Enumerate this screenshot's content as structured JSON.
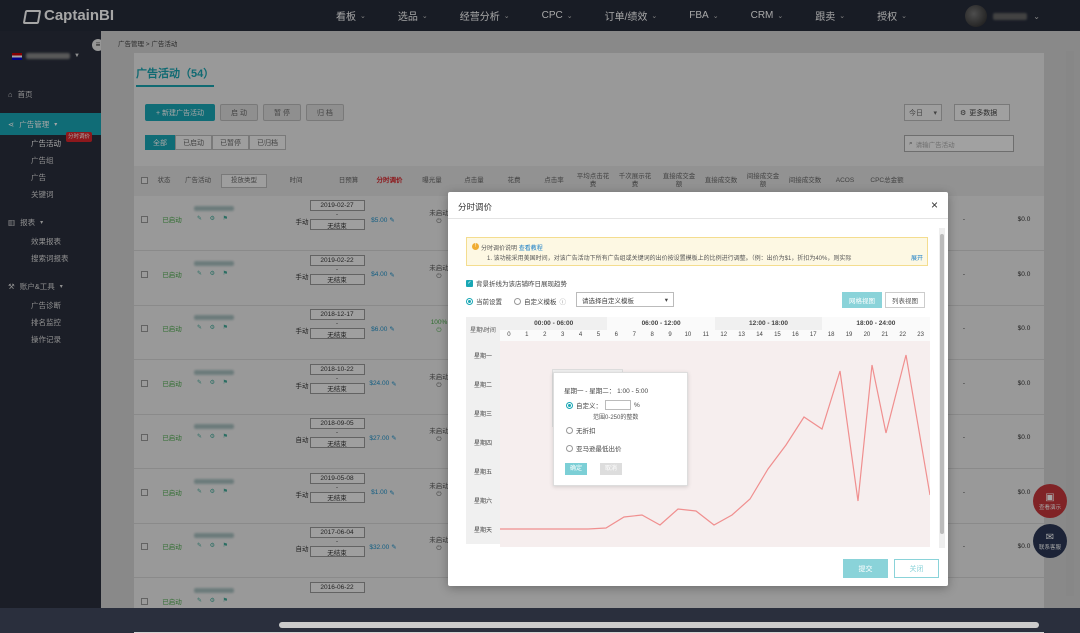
{
  "app": {
    "logo_text": "CaptainBI"
  },
  "nav": [
    {
      "label": "看板"
    },
    {
      "label": "选品"
    },
    {
      "label": "经营分析"
    },
    {
      "label": "CPC"
    },
    {
      "label": "订单/绩效"
    },
    {
      "label": "FBA"
    },
    {
      "label": "CRM"
    },
    {
      "label": "跟卖"
    },
    {
      "label": "授权"
    }
  ],
  "sidebar": {
    "groups": [
      {
        "label": "首页",
        "icon": "home-icon"
      },
      {
        "label": "广告管理",
        "icon": "share-icon",
        "active": true,
        "items": [
          {
            "label": "广告活动",
            "active": true,
            "badge": "分时调价"
          },
          {
            "label": "广告组"
          },
          {
            "label": "广告"
          },
          {
            "label": "关键词"
          }
        ]
      },
      {
        "label": "报表",
        "icon": "chart-icon",
        "items": [
          {
            "label": "效果报表"
          },
          {
            "label": "搜索词报表"
          }
        ]
      },
      {
        "label": "账户&工具",
        "icon": "tools-icon",
        "items": [
          {
            "label": "广告诊断"
          },
          {
            "label": "排名监控"
          },
          {
            "label": "操作记录"
          }
        ]
      }
    ]
  },
  "breadcrumb": "广告管理 > 广告活动",
  "page": {
    "title": "广告活动（54）",
    "toolbar": {
      "new": "+ 新建广告活动",
      "enable": "启 动",
      "pause": "暂 停",
      "archive": "归 档"
    },
    "tabs": [
      "全部",
      "已启动",
      "已暂停",
      "已归档"
    ],
    "period": "今日",
    "more_data": "更多数据",
    "search_placeholder": "请输广告活动"
  },
  "table": {
    "headers": [
      "状态",
      "广告活动",
      "投放类型",
      "时间",
      "日预算",
      "分时调价",
      "曝光量",
      "点击量",
      "花费",
      "点击率",
      "平均点击花费",
      "千次展示花费",
      "直接成交金额",
      "直接成交数",
      "间接成交金额",
      "间接成交数",
      "ACOS",
      "CPC总金额"
    ],
    "rows": [
      {
        "status": "已启动",
        "type": "手动",
        "start": "2019-02-27",
        "end": "无结束",
        "budget": "$5.00",
        "tp": "未启动",
        "last": "$0.0"
      },
      {
        "status": "已启动",
        "type": "手动",
        "start": "2019-02-22",
        "end": "无结束",
        "budget": "$4.00",
        "tp": "未启动",
        "last": "$0.0"
      },
      {
        "status": "已启动",
        "type": "手动",
        "start": "2018-12-17",
        "end": "无结束",
        "budget": "$6.00",
        "tp": "100%",
        "last": "$0.0"
      },
      {
        "status": "已启动",
        "type": "手动",
        "start": "2018-10-22",
        "end": "无结束",
        "budget": "$24.00",
        "tp": "未启动",
        "last": "$0.0"
      },
      {
        "status": "已启动",
        "type": "自动",
        "start": "2018-09-05",
        "end": "无结束",
        "budget": "$27.00",
        "tp": "未启动",
        "last": "$0.0"
      },
      {
        "status": "已启动",
        "type": "手动",
        "start": "2019-05-08",
        "end": "无结束",
        "budget": "$1.00",
        "tp": "未启动",
        "last": "$0.0"
      },
      {
        "status": "已启动",
        "type": "自动",
        "start": "2017-06-04",
        "end": "无结束",
        "budget": "$32.00",
        "tp": "未启动",
        "last": "$0.0"
      },
      {
        "status": "已启动",
        "type": "",
        "start": "2016-06-22",
        "end": "",
        "budget": "",
        "tp": "",
        "last": ""
      }
    ],
    "dash": "-"
  },
  "float": {
    "demo": "查看演示",
    "service": "联系客服"
  },
  "modal": {
    "title": "分时调价",
    "notice_title": "分时调价说明",
    "notice_link": "查看教程",
    "notice_text": "1. 该功能采用美国时间，对该广告活动下所有广告组或关键词的出价按设置模板上的比例进行调整。（例：出价为$1，折扣为40%，则实际",
    "notice_expand": "展开",
    "bg_checkbox": "背景折线为该店铺昨日展现趋势",
    "radio_current": "当前设置",
    "radio_custom": "自定义模板",
    "template_placeholder": "请选择自定义模板",
    "view_grid": "网格视图",
    "view_list": "列表视图",
    "grid": {
      "corner": "星期\\时间",
      "ranges": [
        "00:00 - 06:00",
        "06:00 - 12:00",
        "12:00 - 18:00",
        "18:00 - 24:00"
      ],
      "hours": [
        "0",
        "1",
        "2",
        "3",
        "4",
        "5",
        "6",
        "7",
        "8",
        "9",
        "10",
        "11",
        "12",
        "13",
        "14",
        "15",
        "16",
        "17",
        "18",
        "19",
        "20",
        "21",
        "22",
        "23"
      ],
      "days": [
        "星期一",
        "星期二",
        "星期三",
        "星期四",
        "星期五",
        "星期六",
        "星期天"
      ]
    },
    "popover": {
      "title": "星期一 - 星期二：  1:00 - 5:00",
      "custom": "自定义：",
      "pct": "%",
      "hint": "范围0-250的整数",
      "no_discount": "无折扣",
      "lowest": "亚马逊最低出价",
      "ok": "确定",
      "cancel": "取消"
    },
    "submit": "提交",
    "close": "关闭"
  },
  "colors": {
    "accent": "#19a7b5",
    "status_on": "#4aa84a",
    "price": "#1c8fc7",
    "trend": "#f08f8f"
  }
}
